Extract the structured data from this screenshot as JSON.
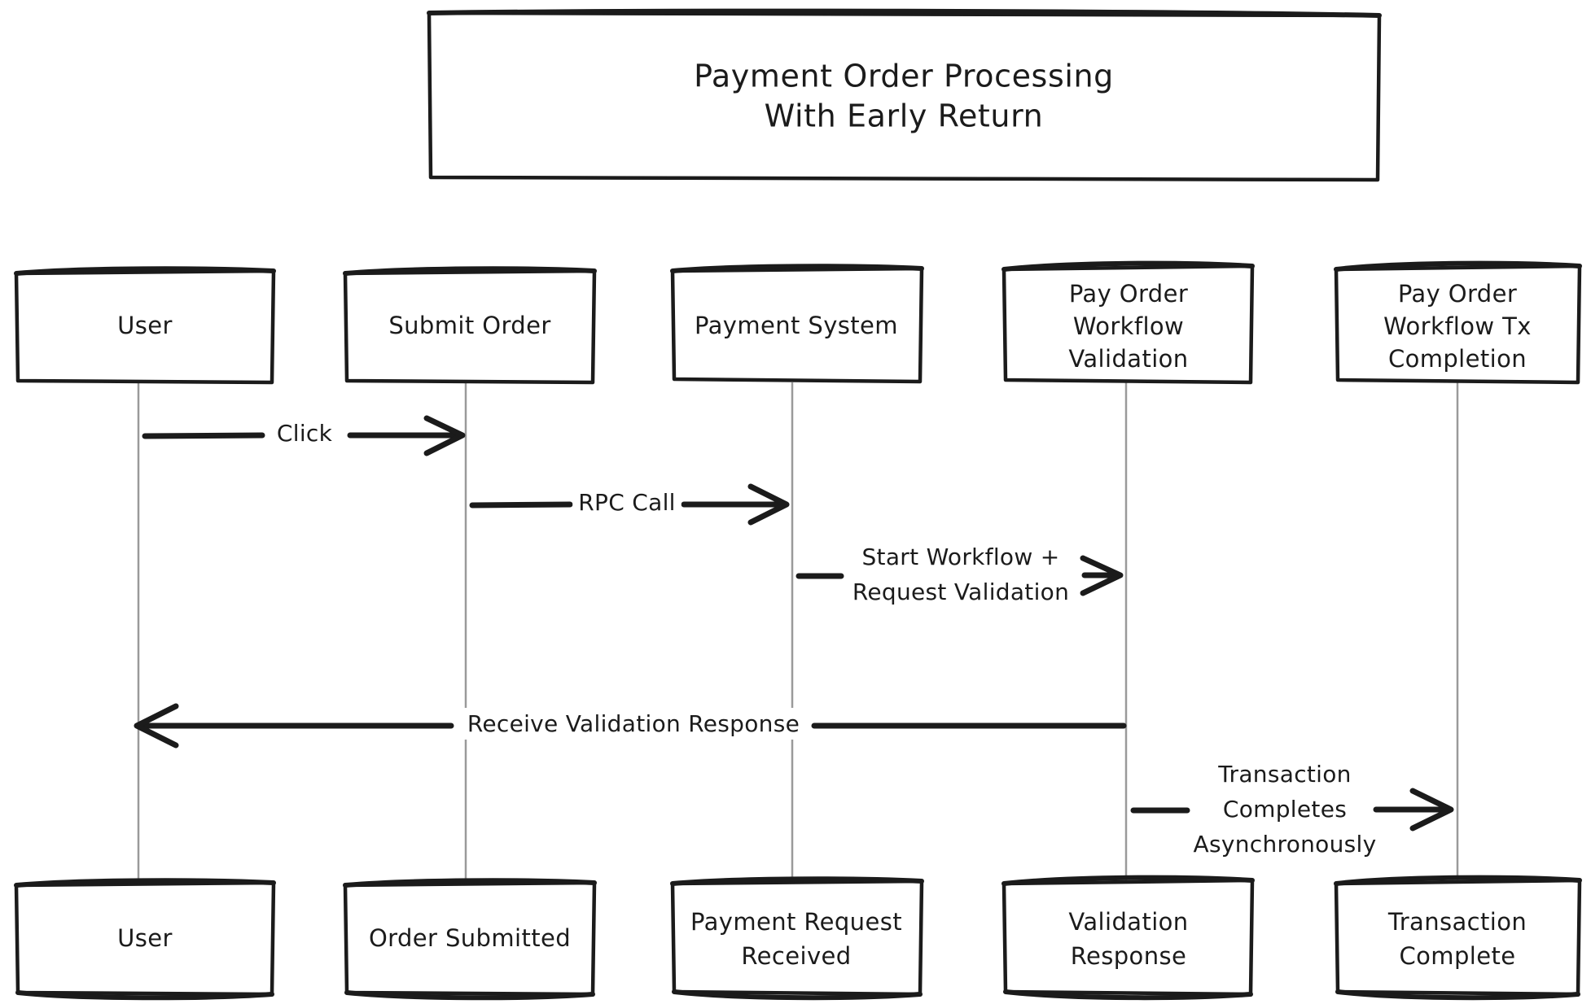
{
  "diagram": {
    "kind": "sequence-diagram",
    "title_lines": [
      "Payment Order Processing",
      "With Early Return"
    ],
    "colors": {
      "stroke": "#1b1b1b",
      "lifeline": "#9a9a9a",
      "background": "#ffffff"
    }
  },
  "participants": [
    {
      "id": "user",
      "top_label_lines": [
        "User"
      ],
      "bottom_label_lines": [
        "User"
      ]
    },
    {
      "id": "submit",
      "top_label_lines": [
        "Submit Order"
      ],
      "bottom_label_lines": [
        "Order Submitted"
      ]
    },
    {
      "id": "paysystem",
      "top_label_lines": [
        "Payment System"
      ],
      "bottom_label_lines": [
        "Payment Request",
        "Received"
      ]
    },
    {
      "id": "validation",
      "top_label_lines": [
        "Pay Order",
        "Workflow",
        "Validation"
      ],
      "bottom_label_lines": [
        "Validation",
        "Response"
      ]
    },
    {
      "id": "completion",
      "top_label_lines": [
        "Pay Order",
        "Workflow Tx",
        "Completion"
      ],
      "bottom_label_lines": [
        "Transaction",
        "Complete"
      ]
    }
  ],
  "messages": [
    {
      "id": "m1",
      "label_lines": [
        "Click"
      ],
      "from": "user",
      "to": "submit",
      "direction": "right"
    },
    {
      "id": "m2",
      "label_lines": [
        "RPC Call"
      ],
      "from": "submit",
      "to": "paysystem",
      "direction": "right"
    },
    {
      "id": "m3",
      "label_lines": [
        "Start Workflow +",
        "Request Validation"
      ],
      "from": "paysystem",
      "to": "validation",
      "direction": "right"
    },
    {
      "id": "m4",
      "label_lines": [
        "Receive Validation Response"
      ],
      "from": "validation",
      "to": "user",
      "direction": "left"
    },
    {
      "id": "m5",
      "label_lines": [
        "Transaction",
        "Completes",
        "Asynchronously"
      ],
      "from": "validation",
      "to": "completion",
      "direction": "right"
    }
  ]
}
